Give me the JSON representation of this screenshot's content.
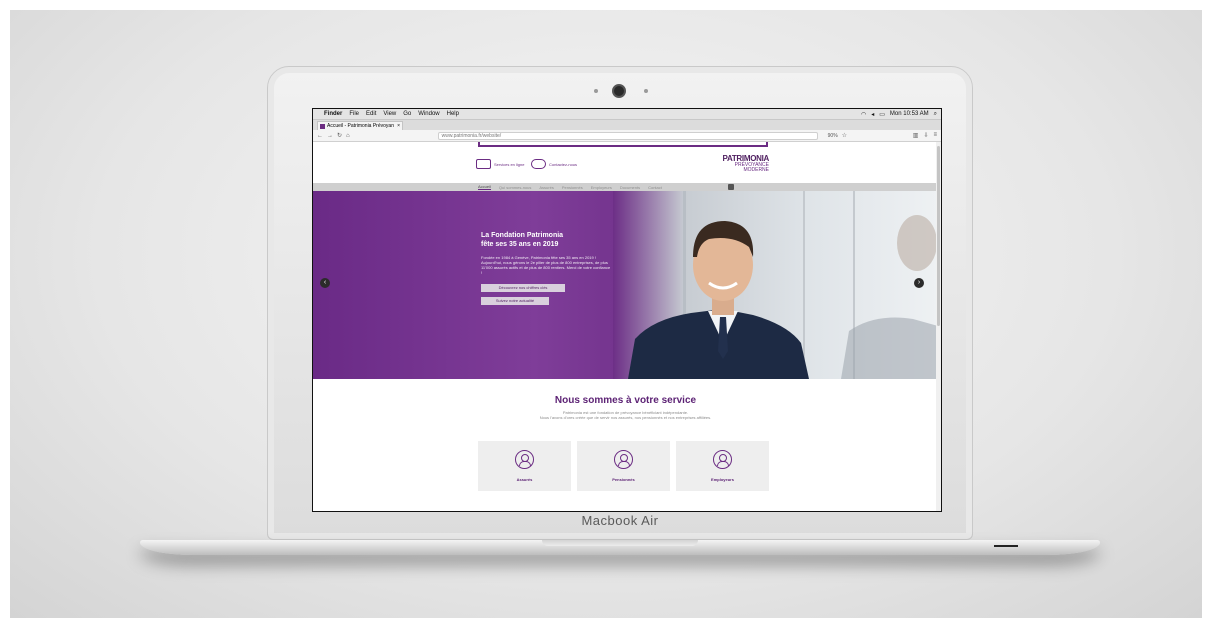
{
  "laptop": {
    "brand": "Macbook Air"
  },
  "os_menubar": {
    "apple_icon": "apple-icon",
    "items": [
      "Finder",
      "File",
      "Edit",
      "View",
      "Go",
      "Window",
      "Help"
    ],
    "clock": "Mon 10:53 AM"
  },
  "browser": {
    "tab_title": "Accueil - Patrimonia Prévoyan",
    "url": "www.patrimonia.fr/website/",
    "zoom": "90%"
  },
  "site": {
    "header_links": [
      "Services en ligne",
      "Contactez-nous"
    ],
    "logo": {
      "line1": "PATRIMONIA",
      "line2": "PRÉVOYANCE",
      "line3": "MODERNE"
    },
    "nav": [
      "Accueil",
      "Qui sommes-nous",
      "Assurés",
      "Pensionnés",
      "Employeurs",
      "Documents",
      "Contact"
    ],
    "hero": {
      "title_line1": "La Fondation Patrimonia",
      "title_line2": "fête ses 35 ans en 2019",
      "body": "Fondée en 1984 à Genève, Patrimonia fête ses 35 ans en 2019 ! Aujourd'hui, nous gérons le 2e pilier de plus de 800 entreprises, de plus 11'000 assurés actifs et de plus de 800 rentiers. Merci de votre confiance !",
      "button1": "Découvrez nos chiffres clés",
      "button2": "Suivez notre actualité"
    },
    "service": {
      "title": "Nous sommes à votre service",
      "subtitle_line1": "Patrimonia est une fondation de prévoyance bénéficiant indépendante.",
      "subtitle_line2": "Nous l'avons d'ores créée que de servir nos assurés, nos pensionnés et nos entreprises affiliées."
    },
    "cards": [
      {
        "label": "Assurés"
      },
      {
        "label": "Pensionnés"
      },
      {
        "label": "Employeurs"
      }
    ]
  },
  "colors": {
    "brand_purple": "#6b2c83",
    "dark_purple": "#5d2375"
  }
}
